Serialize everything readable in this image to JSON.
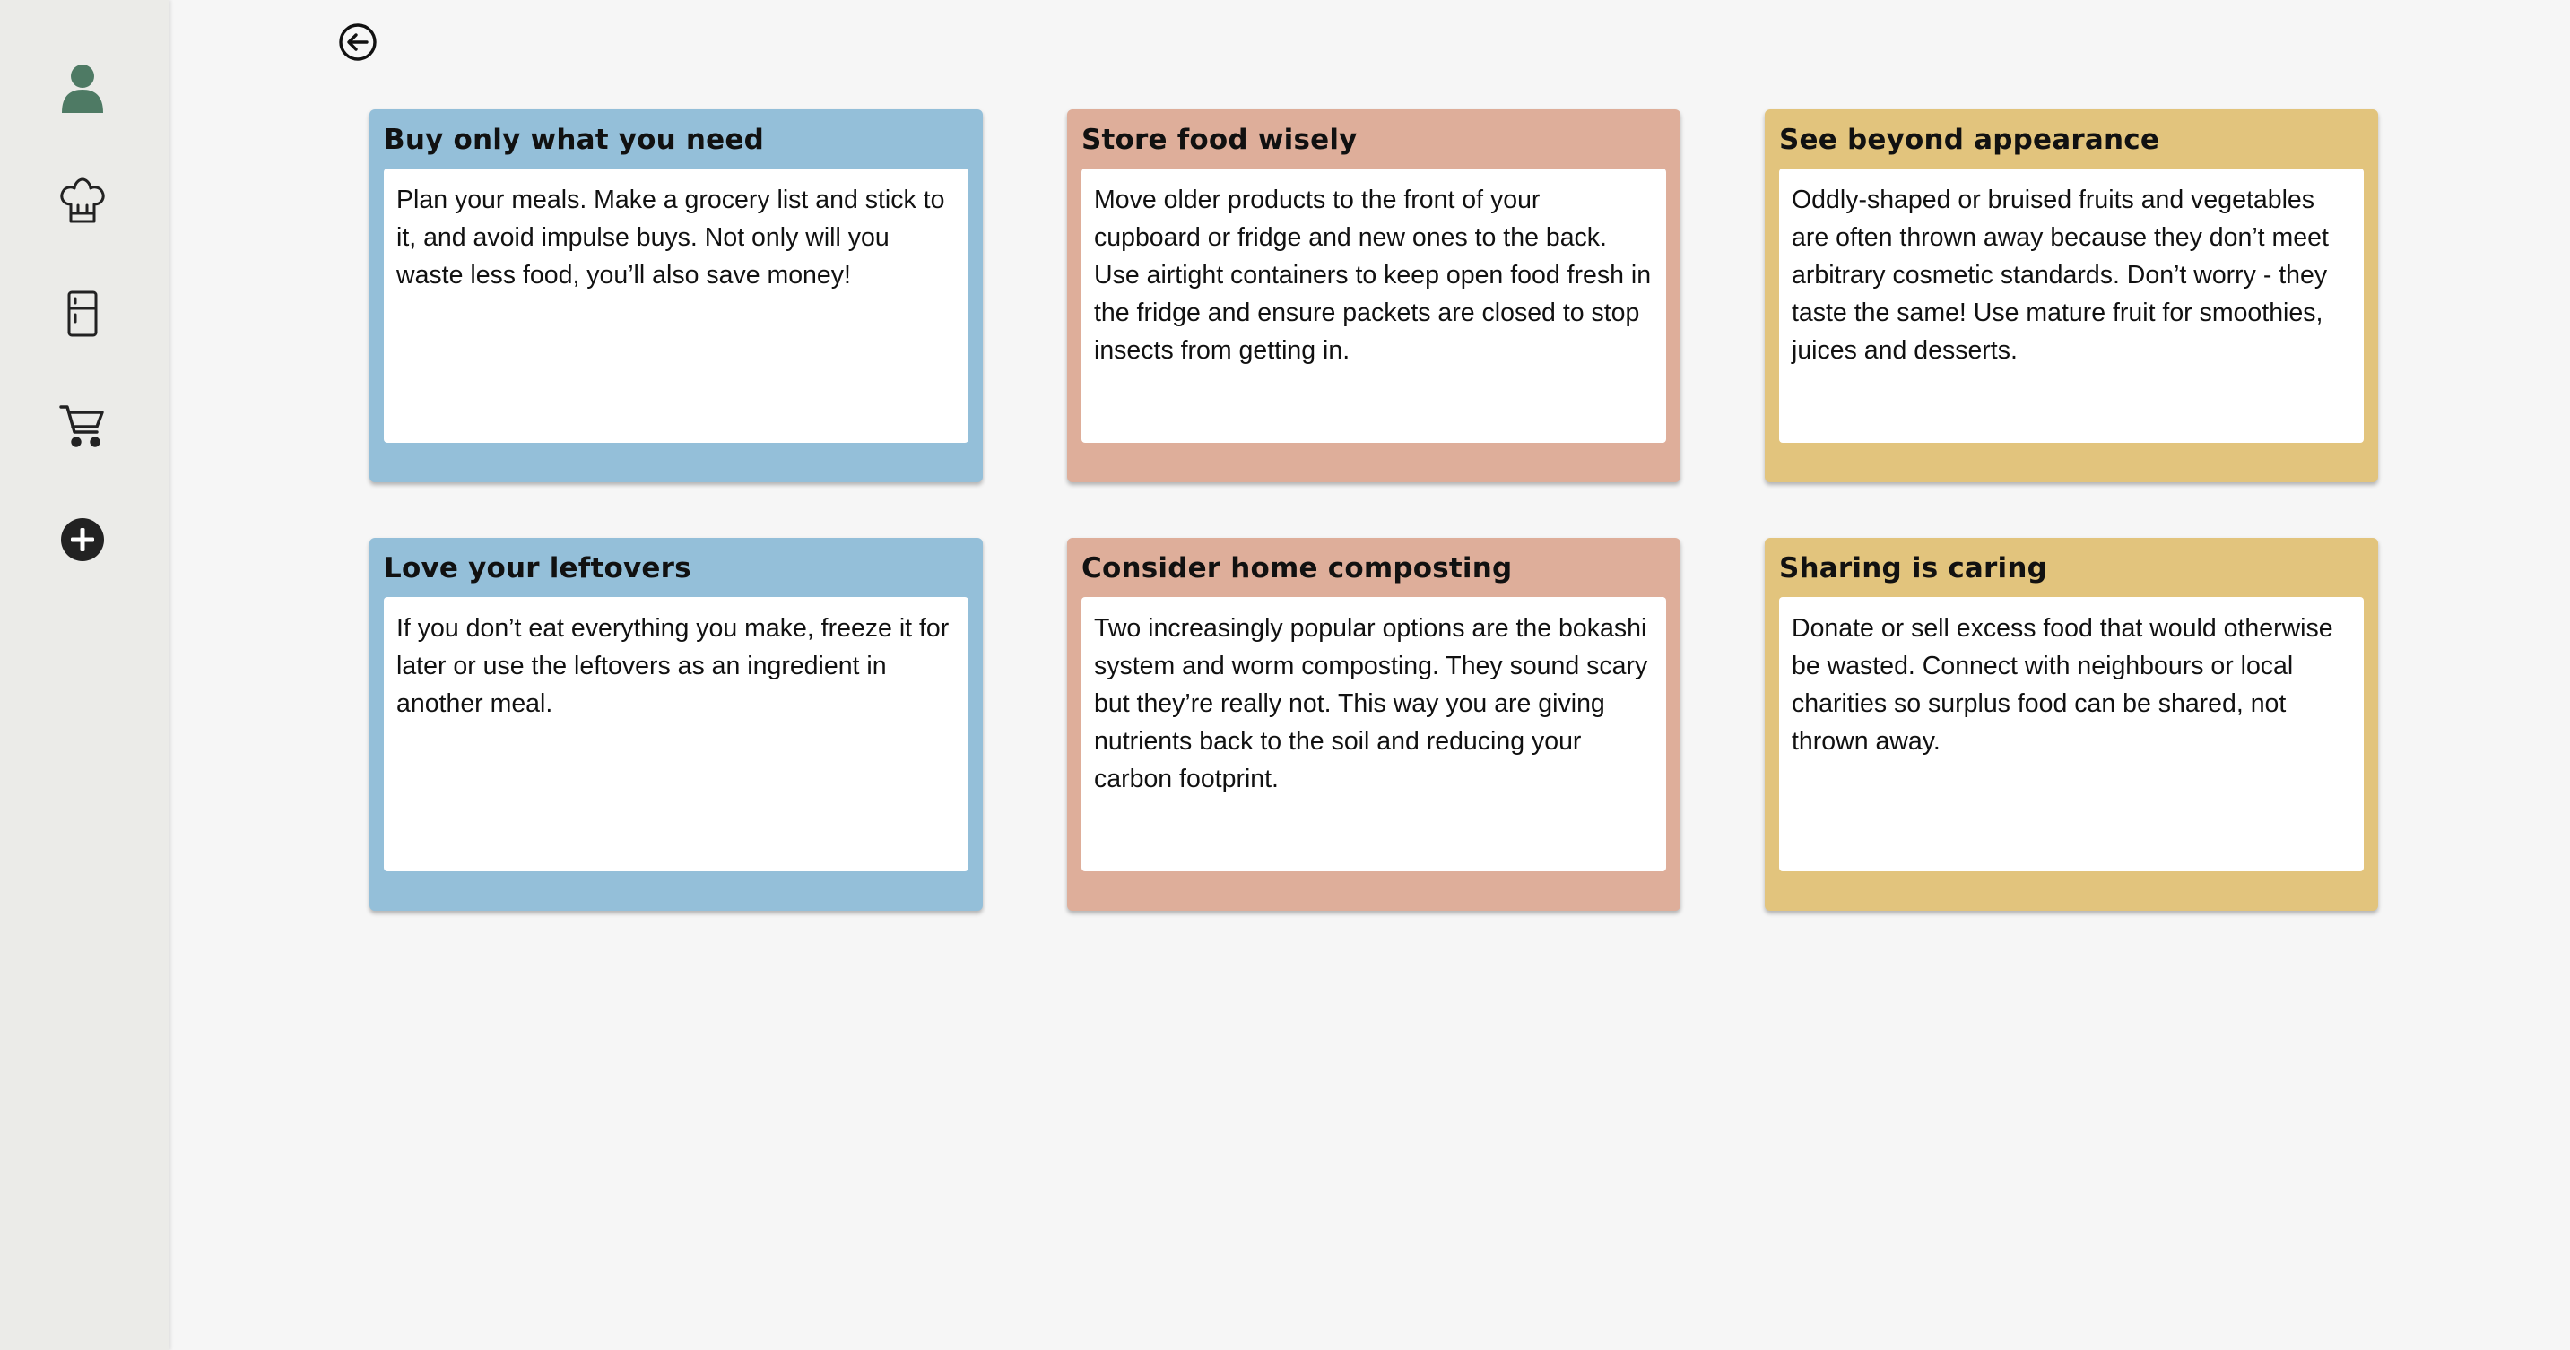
{
  "sidebar": {
    "items": [
      {
        "icon": "user-icon",
        "color": "#4e7a64"
      },
      {
        "icon": "chef-hat-icon",
        "color": "#222222"
      },
      {
        "icon": "fridge-icon",
        "color": "#222222"
      },
      {
        "icon": "shopping-cart-icon",
        "color": "#222222"
      },
      {
        "icon": "add-circle-icon",
        "color": "#222222"
      }
    ]
  },
  "back_button": {
    "icon": "back-arrow-icon"
  },
  "tips": [
    {
      "title": "Buy only what you need",
      "body": "Plan your meals. Make a grocery list and stick to it, and avoid impulse buys. Not only will you waste less food, you’ll also save money!",
      "color": "#94bfd9"
    },
    {
      "title": "Store food wisely",
      "body": "Move older products to the front of your cupboard or fridge and new ones to the back. Use airtight containers to keep open food fresh in the fridge and ensure packets are closed to stop insects from getting in.",
      "color": "#deae9a"
    },
    {
      "title": "See beyond appearance",
      "body": "Oddly-shaped or bruised fruits and vegetables are often thrown away because they don’t meet arbitrary cosmetic standards. Don’t worry - they taste the same! Use mature fruit for smoothies, juices and desserts.",
      "color": "#e2c47d"
    },
    {
      "title": "Love your leftovers",
      "body": "If you don’t eat everything you make, freeze it for later or use the leftovers as an ingredient in another meal.",
      "color": "#94bfd9"
    },
    {
      "title": "Consider home composting",
      "body": "Two increasingly popular options are the bokashi system and worm composting. They sound scary but they’re really not. This way you are giving nutrients back to the soil and reducing your carbon footprint.",
      "color": "#deae9a"
    },
    {
      "title": "Sharing is caring",
      "body": "Donate or sell excess food that would otherwise be wasted. Connect with neighbours or local charities so surplus food can be shared, not thrown away.",
      "color": "#e2c47d"
    }
  ]
}
